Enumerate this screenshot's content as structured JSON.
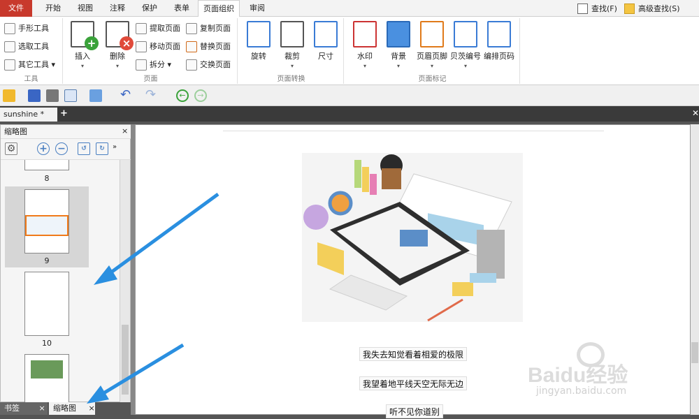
{
  "menu": {
    "tabs": [
      "文件",
      "开始",
      "视图",
      "注释",
      "保护",
      "表单",
      "页面组织",
      "审阅"
    ],
    "active": "页面组织",
    "search": "查找(F)",
    "advanced_search": "高级查找(S)"
  },
  "ribbon": {
    "tools_group": {
      "label": "工具",
      "items": [
        "手形工具",
        "选取工具",
        "其它工具"
      ]
    },
    "pages_group": {
      "label": "页面",
      "insert": "插入",
      "delete": "删除",
      "small": [
        "提取页面",
        "移动页面",
        "拆分",
        "复制页面",
        "替换页面",
        "交换页面"
      ]
    },
    "transform_group": {
      "label": "页面转换",
      "items": [
        "旋转",
        "裁剪",
        "尺寸"
      ]
    },
    "marks_group": {
      "label": "页面标记",
      "items": [
        "水印",
        "背景",
        "页眉页脚",
        "贝茨编号",
        "编排页码"
      ]
    }
  },
  "doc_tab": {
    "name": "sunshine *",
    "add": "+"
  },
  "panel": {
    "title": "缩略图",
    "thumbs": [
      {
        "num": "8"
      },
      {
        "num": "9"
      },
      {
        "num": "10"
      }
    ],
    "bottom_tabs": [
      "书签",
      "缩略图"
    ]
  },
  "document": {
    "lines": [
      "我失去知觉看着相爱的极限",
      "我望着地平线天空无际无边",
      "听不见你道别"
    ]
  },
  "watermark": {
    "brand": "Baidu经验",
    "url": "jingyan.baidu.com"
  },
  "colors": {
    "file_tab": "#c8392c",
    "accent": "#3a7bd5",
    "arrow": "#2a8fe0"
  }
}
